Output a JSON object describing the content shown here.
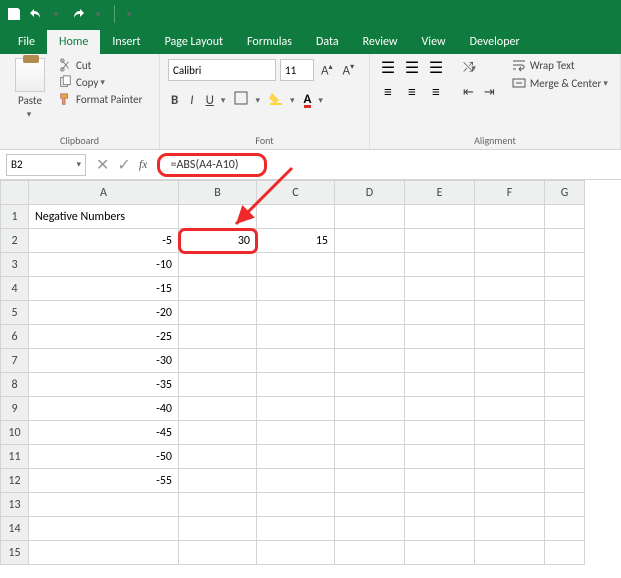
{
  "qat": {
    "save": "save",
    "undo": "undo",
    "redo": "redo"
  },
  "tabs": [
    "File",
    "Home",
    "Insert",
    "Page Layout",
    "Formulas",
    "Data",
    "Review",
    "View",
    "Developer"
  ],
  "active_tab": "Home",
  "ribbon": {
    "clipboard": {
      "paste": "Paste",
      "cut": "Cut",
      "copy": "Copy",
      "format_painter": "Format Painter",
      "label": "Clipboard"
    },
    "font": {
      "name": "Calibri",
      "size": "11",
      "bold": "B",
      "italic": "I",
      "underline": "U",
      "label": "Font"
    },
    "alignment": {
      "wrap": "Wrap Text",
      "merge": "Merge & Center",
      "label": "Alignment"
    }
  },
  "namebox": "B2",
  "formula": "=ABS(A4-A10)",
  "columns": [
    "A",
    "B",
    "C",
    "D",
    "E",
    "F",
    "G"
  ],
  "rows": [
    {
      "n": "1",
      "A": "Negative Numbers",
      "B": "",
      "C": ""
    },
    {
      "n": "2",
      "A": "-5",
      "B": "30",
      "C": "15"
    },
    {
      "n": "3",
      "A": "-10",
      "B": "",
      "C": ""
    },
    {
      "n": "4",
      "A": "-15",
      "B": "",
      "C": ""
    },
    {
      "n": "5",
      "A": "-20",
      "B": "",
      "C": ""
    },
    {
      "n": "6",
      "A": "-25",
      "B": "",
      "C": ""
    },
    {
      "n": "7",
      "A": "-30",
      "B": "",
      "C": ""
    },
    {
      "n": "8",
      "A": "-35",
      "B": "",
      "C": ""
    },
    {
      "n": "9",
      "A": "-40",
      "B": "",
      "C": ""
    },
    {
      "n": "10",
      "A": "-45",
      "B": "",
      "C": ""
    },
    {
      "n": "11",
      "A": "-50",
      "B": "",
      "C": ""
    },
    {
      "n": "12",
      "A": "-55",
      "B": "",
      "C": ""
    },
    {
      "n": "13",
      "A": "",
      "B": "",
      "C": ""
    },
    {
      "n": "14",
      "A": "",
      "B": "",
      "C": ""
    },
    {
      "n": "15",
      "A": "",
      "B": "",
      "C": ""
    }
  ],
  "selected_cell": "B2",
  "highlight": {
    "formula_box": true,
    "cell": "B2",
    "arrow": true
  }
}
